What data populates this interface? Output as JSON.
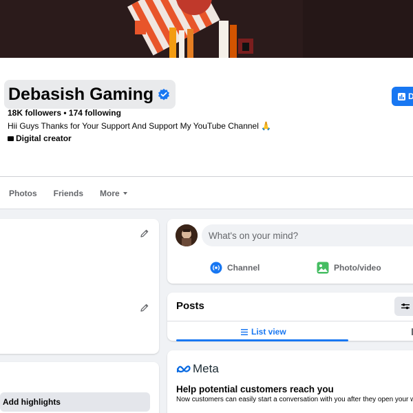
{
  "profile": {
    "name": "Debasish Gaming",
    "stats": "18K followers • 174 following",
    "bio": "Hii Guys Thanks for Your Support And Support My YouTube Channel 🙏",
    "category": "Digital creator",
    "dashboard_label": "D"
  },
  "tabs": [
    {
      "label": "Photos"
    },
    {
      "label": "Friends"
    },
    {
      "label": "More"
    }
  ],
  "left": {
    "add_highlights_label": "Add highlights"
  },
  "composer": {
    "placeholder": "What's on your mind?",
    "actions": [
      {
        "label": "Channel",
        "icon": "channel-icon",
        "color": "#1877f2"
      },
      {
        "label": "Photo/video",
        "icon": "photo-video-icon",
        "color": "#45bd62"
      }
    ]
  },
  "posts": {
    "title": "Posts",
    "view_tab": "List view"
  },
  "meta_promo": {
    "logo_text": "Meta",
    "title": "Help potential customers reach you",
    "subtitle": "Now customers can easily start a conversation with you after they open your w"
  },
  "colors": {
    "accent": "#1877f2",
    "background": "#f0f2f5",
    "muted_text": "#65676b"
  }
}
